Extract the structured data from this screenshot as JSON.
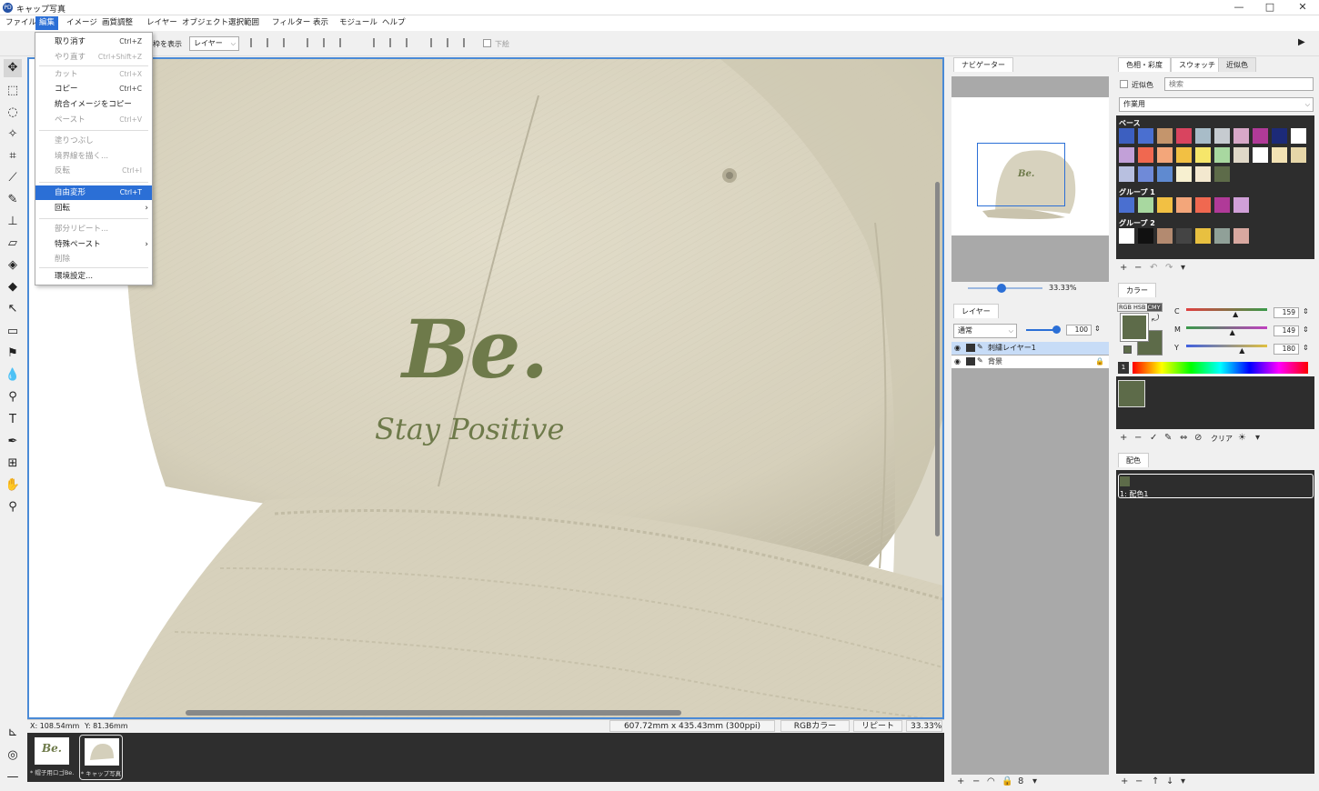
{
  "window": {
    "title": "キャップ写真",
    "logo": "PD",
    "controls": [
      "—",
      "□",
      "✕"
    ]
  },
  "menubar": [
    "ファイル",
    "編集",
    "イメージ",
    "画質調整",
    "レイヤー",
    "オブジェクト",
    "選択範囲",
    "フィルター",
    "表示",
    "モジュール",
    "ヘルプ"
  ],
  "optionbar": {
    "frame_label": "枠を表示",
    "layer_select": "レイヤー",
    "below_label": "下絵",
    "play_icon": "▶"
  },
  "edit_menu": {
    "undo": {
      "label": "取り消す",
      "shortcut": "Ctrl+Z"
    },
    "redo": {
      "label": "やり直す",
      "shortcut": "Ctrl+Shift+Z"
    },
    "cut": {
      "label": "カット",
      "shortcut": "Ctrl+X"
    },
    "copy": {
      "label": "コピー",
      "shortcut": "Ctrl+C"
    },
    "copy_merged": {
      "label": "統合イメージをコピー",
      "shortcut": ""
    },
    "paste": {
      "label": "ペースト",
      "shortcut": "Ctrl+V"
    },
    "fill": {
      "label": "塗りつぶし",
      "shortcut": ""
    },
    "stroke": {
      "label": "境界線を描く...",
      "shortcut": ""
    },
    "invert": {
      "label": "反転",
      "shortcut": "Ctrl+I"
    },
    "free_transform": {
      "label": "自由変形",
      "shortcut": "Ctrl+T"
    },
    "rotate": {
      "label": "回転",
      "arrow": "›"
    },
    "partial_repeat": {
      "label": "部分リピート...",
      "shortcut": ""
    },
    "special_paste": {
      "label": "特殊ペースト",
      "arrow": "›"
    },
    "delete": {
      "label": "削除",
      "shortcut": ""
    },
    "preferences": {
      "label": "環境設定...",
      "shortcut": ""
    }
  },
  "canvas": {
    "logo_text": "Be.",
    "tagline": "Stay Positive",
    "embroidery_color": "#6e7a4a",
    "cap_color": "#d9d4c0"
  },
  "statusbar": {
    "x": "X: 108.54mm",
    "y": "Y: 81.36mm",
    "size": "607.72mm x 435.43mm (300ppi)",
    "mode": "RGBカラー",
    "repeat": "リピートオフ",
    "zoom": "33.33%"
  },
  "docs": [
    {
      "caption": "* 帽子用ロゴBe..."
    },
    {
      "caption": "* キャップ写真"
    }
  ],
  "navigator": {
    "tab": "ナビゲーター",
    "zoom": "33.33%",
    "slider_fraction": 0.45
  },
  "layers": {
    "tab": "レイヤー",
    "blend": "通常",
    "opacity": "100",
    "items": [
      {
        "name": "刺繍レイヤー1",
        "selected": true
      },
      {
        "name": "背景",
        "selected": false
      }
    ],
    "footer_icons": [
      "+",
      "−",
      "◠",
      "🔒",
      "8",
      "▾"
    ]
  },
  "swatches": {
    "tabs": [
      "色相・彩度",
      "スウォッチ",
      "近似色"
    ],
    "active_tab": 1,
    "similar_label": "近似色",
    "search_placeholder": "検索",
    "set_select": "作業用",
    "groups": [
      {
        "name": "ベース",
        "colors": [
          "#3c5fc0",
          "#4a6fd0",
          "#c4956c",
          "#d9445f",
          "#a8bcc8",
          "#c6cbd0",
          "#d8a8c8",
          "#b03a98",
          "#1c2a78",
          "#ffffff",
          "#c2a0d8",
          "#f06850",
          "#f3a67a",
          "#f2c043",
          "#f6e66a",
          "#a8d8a0",
          "#e0d8c8",
          "#ffffff",
          "#f2e2b4",
          "#e6d6a8",
          "#b8c0e0",
          "#6f8ad8",
          "#5f8ad0",
          "#f7f0d0",
          "#f3e8cf",
          "#5d6b49"
        ]
      },
      {
        "name": "グループ 1",
        "colors": [
          "#4a6fd0",
          "#a8d8a0",
          "#f2c043",
          "#f3a67a",
          "#f06850",
          "#b03a98",
          "#d0a0d8"
        ]
      },
      {
        "name": "グループ 2",
        "colors": [
          "#ffffff",
          "#111111",
          "#b38a70",
          "#444444",
          "#e8c040",
          "#90a098",
          "#d8a8a0"
        ]
      }
    ],
    "footer_icons": [
      "+",
      "−",
      "↶",
      "↷",
      "▾"
    ]
  },
  "color": {
    "tab": "カラー",
    "modes": [
      "RGB",
      "HSB",
      "CMY"
    ],
    "active_mode": 2,
    "channels": [
      {
        "label": "C",
        "value": "159",
        "fraction": 0.62
      },
      {
        "label": "M",
        "value": "149",
        "fraction": 0.58
      },
      {
        "label": "Y",
        "value": "180",
        "fraction": 0.7
      }
    ],
    "fg": "#5d6b49",
    "bg": "#5d6b49",
    "recent_label": "1",
    "footer": [
      "+",
      "−",
      "✓",
      "✎",
      "⇔",
      "⊘",
      "クリア",
      "☀",
      "▾"
    ]
  },
  "scheme": {
    "tab": "配色",
    "item": "1: 配色1",
    "color": "#5d6b49",
    "footer_icons": [
      "+",
      "−",
      "↑",
      "↓",
      "▾"
    ]
  }
}
